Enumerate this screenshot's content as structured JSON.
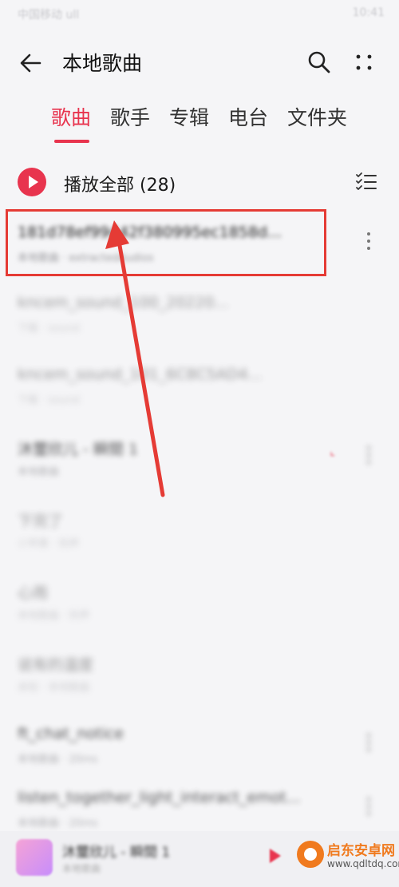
{
  "statusbar": {
    "left": "中国移动 ull",
    "right": "10:41"
  },
  "header": {
    "title": "本地歌曲"
  },
  "tabs": [
    {
      "label": "歌曲",
      "active": true
    },
    {
      "label": "歌手",
      "active": false
    },
    {
      "label": "专辑",
      "active": false
    },
    {
      "label": "电台",
      "active": false
    },
    {
      "label": "文件夹",
      "active": false
    }
  ],
  "playall": {
    "label": "播放全部 (28)"
  },
  "songs": [
    {
      "title": "181d78ef99442f380995ec1858d...",
      "subtitle": "本地歌曲 · extractedAudios"
    },
    {
      "title": "kncem_sound_100_20220...",
      "subtitle": "下载 · sound"
    },
    {
      "title": "kncem_sound_101_6C8C5AD4...",
      "subtitle": "下载 · sound"
    },
    {
      "title": "沐璽欣儿 - 瞬間 1",
      "subtitle": "本地歌曲"
    },
    {
      "title": "下完了",
      "subtitle": "小苹果 · 铃声"
    },
    {
      "title": "心雨",
      "subtitle": "本地歌曲 · 铃声"
    },
    {
      "title": "说有的温度",
      "subtitle": "未知 · 本地歌曲"
    },
    {
      "title": "ft_chat_notice",
      "subtitle": "本地歌曲 · 20ms"
    },
    {
      "title": "listen_together_light_interact_emot...",
      "subtitle": "本地歌曲 · 20ms"
    }
  ],
  "miniplayer": {
    "title": "沐璽欣儿 - 瞬間 1",
    "subtitle": "本地歌曲"
  },
  "watermark": {
    "cn": "启东安卓网",
    "url": "www.qdltdq.com"
  },
  "colors": {
    "accent": "#e8344e",
    "annotation": "#e53b35",
    "watermark": "#f07a1e"
  }
}
